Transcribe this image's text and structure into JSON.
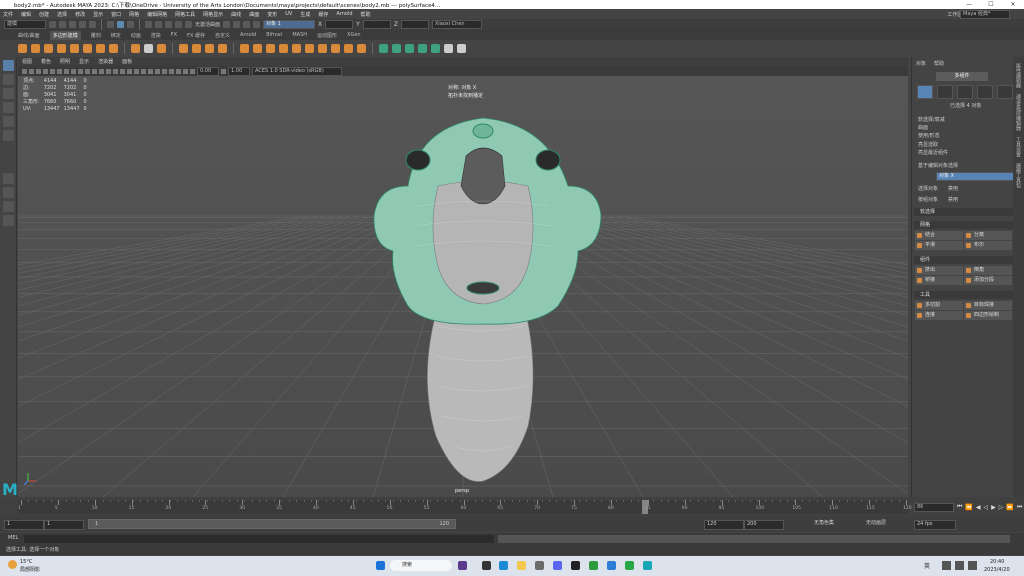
{
  "window": {
    "title": "body2.mb* - Autodesk MAYA 2023: C:\\下载\\OneDrive - University of the Arts London\\Documents\\maya\\projects\\default\\scenes\\body2.mb --- polySurface4...",
    "controls": [
      "—",
      "☐",
      "✕"
    ]
  },
  "menubar": {
    "items": [
      "文件",
      "编辑",
      "创建",
      "选择",
      "修改",
      "显示",
      "窗口",
      "网格",
      "编辑网格",
      "网格工具",
      "网格显示",
      "曲线",
      "曲面",
      "变形",
      "UV",
      "生成",
      "缓存",
      "Arnold",
      "帮助"
    ],
    "workspace_label": "工作区:",
    "workspace_value": "Maya 经典*"
  },
  "statusline": {
    "mode": "建模",
    "object_field": "对象 1",
    "no_live": "无激活曲面",
    "x_label": "X",
    "y_label": "Y",
    "z_label": "Z",
    "user": "Xiaoxi Chen"
  },
  "shelf_tabs": [
    "曲线/曲面",
    "多边形建模",
    "雕刻",
    "绑定",
    "动画",
    "渲染",
    "FX",
    "FX 缓存",
    "自定义",
    "Arnold",
    "Bifrost",
    "MASH",
    "运动图形",
    "XGen"
  ],
  "shelf_active_tab": "多边形建模",
  "panel_menu": [
    "视图",
    "着色",
    "照明",
    "显示",
    "渲染器",
    "面板"
  ],
  "panel_toolbar": {
    "exposure": "0.00",
    "gamma": "1.00",
    "color_space": "ACES 1.0 SDR-video (sRGB)"
  },
  "hud": {
    "rows": [
      {
        "label": "顶点:",
        "a": "4144",
        "b": "4144",
        "c": "0"
      },
      {
        "label": "边:",
        "a": "7202",
        "b": "7202",
        "c": "0"
      },
      {
        "label": "面:",
        "a": "3041",
        "b": "3041",
        "c": "0"
      },
      {
        "label": "三角形:",
        "a": "7660",
        "b": "7660",
        "c": "0"
      },
      {
        "label": "UV:",
        "a": "13447",
        "b": "13447",
        "c": "0"
      }
    ]
  },
  "viewport_overlay": {
    "line1": "对称: 对象 X",
    "line2": "拓扑未找到播定",
    "camera": "persp"
  },
  "right_panel": {
    "tabs": [
      "对象",
      "帮助"
    ],
    "multi_component": "多组件",
    "selected_info": "已选择 4 对象",
    "options": [
      "软选择/衰减",
      "曲面",
      "使用/形态",
      "亮显选取",
      "亮显最近组件"
    ],
    "symmetry_label": "基于编辑对象选择",
    "object_label": "对象 X",
    "select_label1": "选择对象",
    "select_label1_value": "禁用",
    "select_label2": "按组对象",
    "select_label2_value": "禁用",
    "soft_select": "软选择",
    "section_mesh": "网格",
    "mesh_buttons": [
      "结合",
      "分离",
      "平滑",
      "布尔"
    ],
    "section_components": "组件",
    "comp_buttons": [
      "挤出",
      "倒角",
      "桥接",
      "添加分段"
    ],
    "section_tools": "工具",
    "tool_buttons": [
      "多切割",
      "目标焊接",
      "连接",
      "四边形绘制"
    ]
  },
  "side_tabs": [
    "属性编辑器",
    "通道盒/层编辑器",
    "工具设置",
    "建模工具包"
  ],
  "timeline": {
    "ticks": [
      "1",
      "5",
      "10",
      "15",
      "20",
      "25",
      "30",
      "35",
      "40",
      "45",
      "50",
      "55",
      "60",
      "65",
      "70",
      "75",
      "80",
      "85",
      "90",
      "95",
      "100",
      "105",
      "110",
      "115",
      "120"
    ],
    "current_frame": "86"
  },
  "range_bar": {
    "start": "1",
    "start2": "1",
    "range_start_label": "1",
    "range_end_label": "120",
    "end": "120",
    "end2": "200",
    "no_char": "无角色集",
    "no_anim_layer": "无动画层",
    "fps": "24 fps"
  },
  "mel_label": "MEL",
  "help_line": "选择工具: 选择一个对象",
  "taskbar": {
    "weather_temp": "15°C",
    "weather_text": "局部阴影",
    "search": "搜索",
    "ime": "英",
    "time": "20:40",
    "date": "2023/4/20"
  }
}
